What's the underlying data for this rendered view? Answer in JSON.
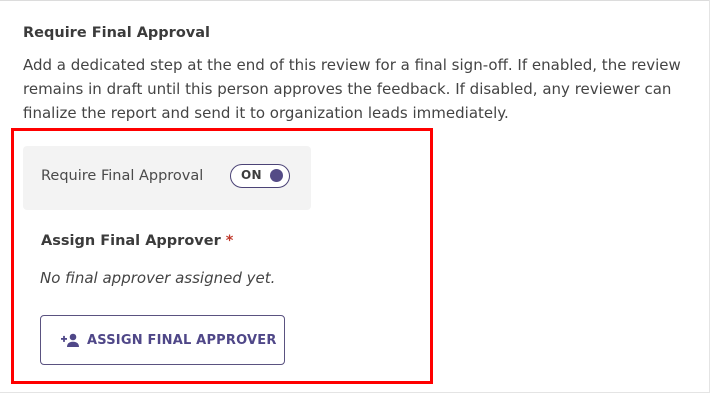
{
  "section": {
    "title": "Require Final Approval",
    "description": "Add a dedicated step at the end of this review for a final sign-off. If enabled, the review remains in draft until this person approves the feedback. If disabled, any reviewer can finalize the report and send it to organization leads immediately."
  },
  "toggle": {
    "label": "Require Final Approval",
    "state_text": "ON",
    "enabled": true
  },
  "approver": {
    "title": "Assign Final Approver",
    "required_marker": "*",
    "empty_text": "No final approver assigned yet.",
    "button_label": "ASSIGN FINAL APPROVER",
    "button_icon": "person-add-icon"
  },
  "colors": {
    "accent": "#544b86",
    "highlight": "#ff0000",
    "required": "#c0392b",
    "panel_bg": "#f3f3f3"
  }
}
